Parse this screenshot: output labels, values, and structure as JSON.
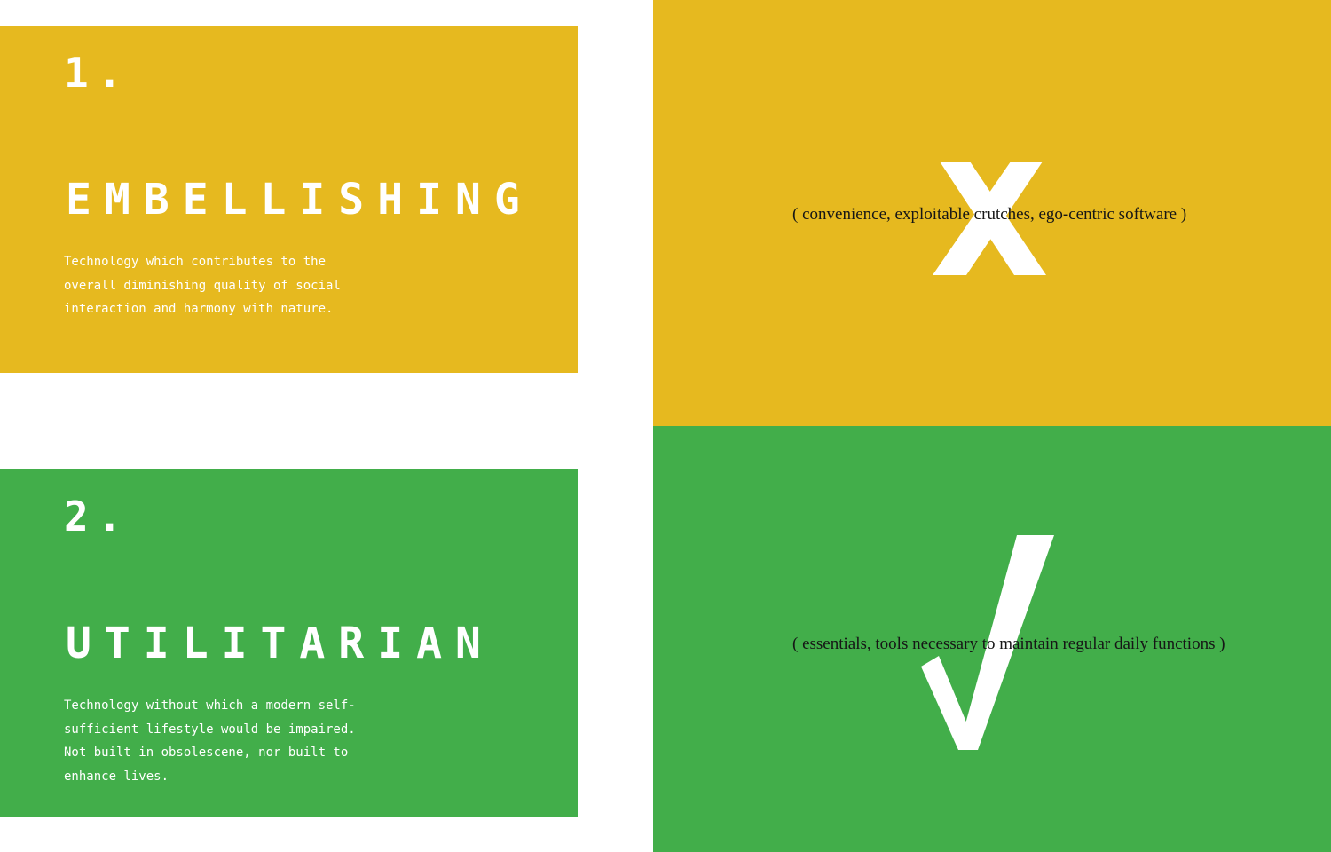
{
  "colors": {
    "yellow": "#e6b91f",
    "green": "#42ae4a",
    "white": "#ffffff",
    "caption_text": "#161616"
  },
  "cards": [
    {
      "number": "1.",
      "heading": "EMBELLISHING",
      "description": "Technology which contributes to the overall diminishing quality of social interaction and harmony with nature."
    },
    {
      "number": "2.",
      "heading": "UTILITARIAN",
      "description": "Technology without which a modern self-sufficient lifestyle would be impaired. Not built in obsolescene, nor built to enhance lives."
    }
  ],
  "panels": [
    {
      "icon": "x-mark-icon",
      "caption": "( convenience, exploitable crutches, ego-centric software )"
    },
    {
      "icon": "check-mark-icon",
      "caption": "( essentials, tools necessary to maintain regular daily functions )"
    }
  ]
}
